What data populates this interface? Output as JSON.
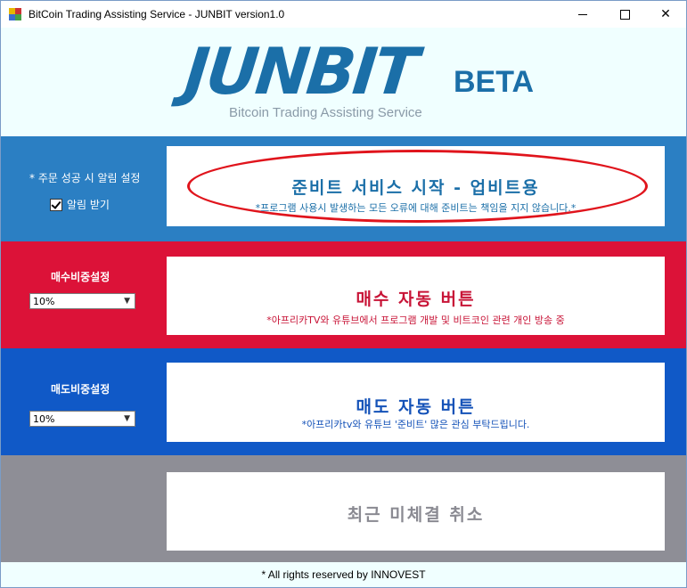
{
  "window": {
    "title": "BitCoin Trading Assisting Service - JUNBIT version1.0",
    "controls": {
      "minimize": "minimize-icon",
      "maximize": "maximize-icon",
      "close": "close-icon"
    }
  },
  "header": {
    "logo_main": "JUNBIT",
    "logo_badge": "BETA",
    "tagline": "Bitcoin Trading Assisting Service",
    "logo_color": "#1b6fa8"
  },
  "alert_section": {
    "label": "* 주문 성공 시 알림 설정",
    "checkbox_label": "알림 받기",
    "checkbox_checked": true,
    "button_title": "준비트 서비스 시작 - 업비트용",
    "button_note": "*프로그램 사용시 발생하는 모든 오류에 대해 준비트는 책임을 지지 않습니다.*",
    "band_color": "#2b7fc3",
    "title_color": "#1b6fa8",
    "highlight_color": "#e0141c"
  },
  "buy_section": {
    "label": "매수비중설정",
    "select_value": "10%",
    "button_title": "매수 자동 버튼",
    "button_note": "*아프리카TV와 유튜브에서 프로그램 개발 및 비트코인 관련 개인 방송 중",
    "band_color": "#dc1238",
    "title_color": "#c81437"
  },
  "sell_section": {
    "label": "매도비중설정",
    "select_value": "10%",
    "button_title": "매도 자동 버튼",
    "button_note": "*아프리카tv와 유튜브 '준비트' 많은 관심 부탁드립니다.",
    "band_color": "#1059c7",
    "title_color": "#1452b8"
  },
  "cancel_section": {
    "button_title": "최근 미체결 취소",
    "band_color": "#8e8e96",
    "title_color": "#8a8a92"
  },
  "footer": {
    "text": "* All rights reserved by INNOVEST"
  }
}
